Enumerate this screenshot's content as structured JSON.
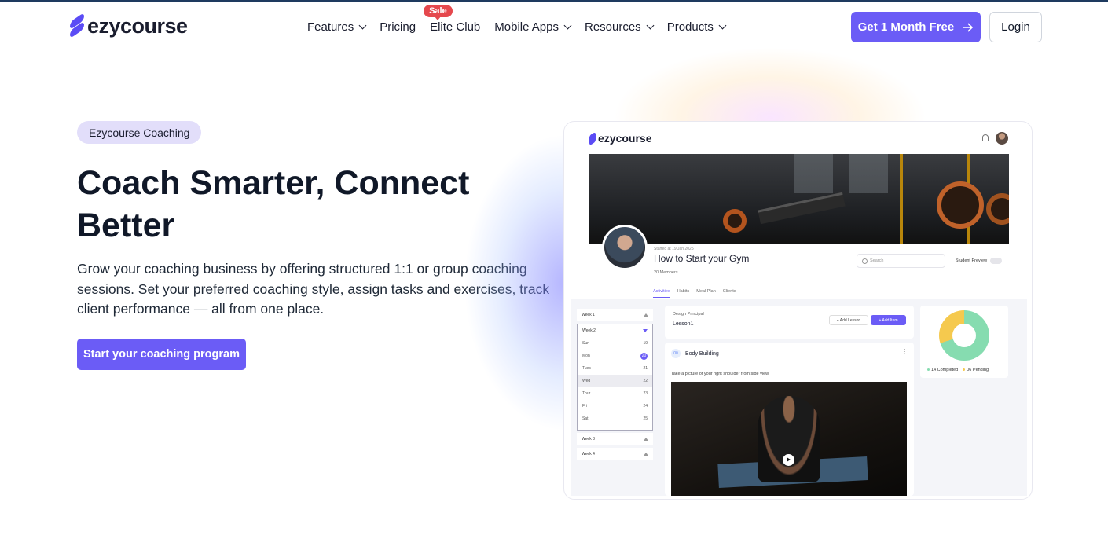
{
  "header": {
    "logo_text": "ezycourse",
    "nav": [
      {
        "label": "Features",
        "dropdown": true
      },
      {
        "label": "Pricing",
        "dropdown": false
      },
      {
        "label": "Elite Club",
        "dropdown": false,
        "badge": "Sale"
      },
      {
        "label": "Mobile Apps",
        "dropdown": true
      },
      {
        "label": "Resources",
        "dropdown": true
      },
      {
        "label": "Products",
        "dropdown": true
      }
    ],
    "cta_label": "Get 1 Month Free",
    "login_label": "Login"
  },
  "hero": {
    "eyebrow": "Ezycourse Coaching",
    "title": "Coach Smarter, Connect Better",
    "subtitle": "Grow your coaching business by offering structured 1:1 or group coaching sessions. Set your preferred coaching style, assign tasks and exercises, track client performance — all from one place.",
    "button_label": "Start your coaching program"
  },
  "preview": {
    "logo_text": "ezycourse",
    "started_text": "Started at 19 Jan 2025",
    "program_title": "How to Start your Gym",
    "members": "20 Members",
    "search_placeholder": "Search",
    "student_preview": "Student Preview",
    "tabs": [
      "Activities",
      "Habits",
      "Meal Plan",
      "Clients"
    ],
    "weeks": {
      "week1": "Week 1",
      "week2": "Week 2",
      "week3": "Week 3",
      "week4": "Week 4",
      "days": [
        {
          "name": "Sun",
          "num": "19"
        },
        {
          "name": "Mon",
          "num": "20"
        },
        {
          "name": "Tues",
          "num": "21"
        },
        {
          "name": "Wed",
          "num": "22"
        },
        {
          "name": "Thur",
          "num": "23"
        },
        {
          "name": "Fri",
          "num": "24"
        },
        {
          "name": "Sat",
          "num": "25"
        }
      ]
    },
    "lesson": {
      "label": "Design Principal",
      "name": "Lesson1",
      "add_lesson": "+ Add Lesson",
      "add_item": "+ Add Item"
    },
    "activity": {
      "icon_text": "00",
      "title": "Body Building",
      "description": "Take a picture of your right shoulder from side view"
    },
    "progress": {
      "completed": 14,
      "pending": 6,
      "completed_label": "14 Completed",
      "pending_label": "06 Pending",
      "completed_color": "#86dcb0",
      "pending_color": "#f5c94e"
    }
  },
  "colors": {
    "accent": "#6b5cf6",
    "sale": "#e5484d",
    "text": "#101828"
  }
}
